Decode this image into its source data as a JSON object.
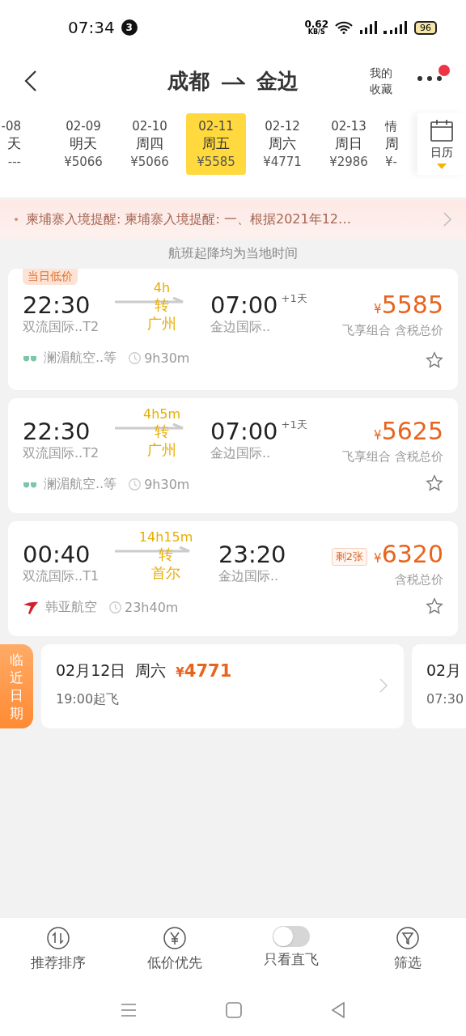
{
  "status_bar": {
    "time": "07:34",
    "notification_count": "3",
    "net_speed": "0.62",
    "net_unit": "KB/S",
    "battery": "96"
  },
  "header": {
    "from": "成都",
    "to": "金边",
    "favorites": "我的收藏",
    "more_badge": true
  },
  "dates": [
    {
      "date": "-08",
      "day": "天",
      "price": "---",
      "selected": false
    },
    {
      "date": "02-09",
      "day": "明天",
      "price": "¥5066",
      "selected": false
    },
    {
      "date": "02-10",
      "day": "周四",
      "price": "¥5066",
      "selected": false
    },
    {
      "date": "02-11",
      "day": "周五",
      "price": "¥5585",
      "selected": true
    },
    {
      "date": "02-12",
      "day": "周六",
      "price": "¥4771",
      "selected": false
    },
    {
      "date": "02-13",
      "day": "周日",
      "price": "¥2986",
      "selected": false
    },
    {
      "date": "情",
      "day": "周",
      "price": "¥-",
      "selected": false
    }
  ],
  "calendar": {
    "label": "日历"
  },
  "notice": {
    "text": "柬埔寨入境提醒: 柬埔寨入境提醒:   一、根据2021年12…"
  },
  "time_note": "航班起降均为当地时间",
  "flights": [
    {
      "tag": "当日低价",
      "dep_time": "22:30",
      "dep_airport": "双流国际..T2",
      "duration": "4h",
      "transfer": "转",
      "via": "广州",
      "arr_time": "07:00",
      "day_offset": "+1天",
      "arr_airport": "金边国际..",
      "currency": "¥",
      "price": "5585",
      "price_note": "飞享组合 含税总价",
      "airline": {
        "kind": "glasses",
        "name": "澜湄航空..等"
      },
      "flight_time": "9h30m",
      "favorite": false
    },
    {
      "dep_time": "22:30",
      "dep_airport": "双流国际..T2",
      "duration": "4h5m",
      "transfer": "转",
      "via": "广州",
      "arr_time": "07:00",
      "day_offset": "+1天",
      "arr_airport": "金边国际..",
      "currency": "¥",
      "price": "5625",
      "price_note": "飞享组合 含税总价",
      "airline": {
        "kind": "glasses",
        "name": "澜湄航空..等"
      },
      "flight_time": "9h30m",
      "favorite": false
    },
    {
      "dep_time": "00:40",
      "dep_airport": "双流国际..T1",
      "duration": "14h15m",
      "transfer": "转",
      "via": "首尔",
      "arr_time": "23:20",
      "arr_airport": "金边国际..",
      "stock": "剩2张",
      "currency": "¥",
      "price": "6320",
      "price_note": "含税总价",
      "airline": {
        "kind": "swoosh",
        "name": "韩亚航空"
      },
      "flight_time": "23h40m",
      "favorite": false
    }
  ],
  "nearby": {
    "label": "临近日期",
    "items": [
      {
        "date": "02月12日",
        "day": "周六",
        "currency": "¥",
        "price": "4771",
        "depart": "19:00起飞"
      },
      {
        "date": "02月",
        "depart": "07:30"
      }
    ]
  },
  "bottom_bar": [
    {
      "kind": "sort",
      "label": "推荐排序"
    },
    {
      "kind": "price",
      "label": "低价优先"
    },
    {
      "kind": "toggle",
      "label": "只看直飞",
      "on": false
    },
    {
      "kind": "filter",
      "label": "筛选"
    }
  ]
}
